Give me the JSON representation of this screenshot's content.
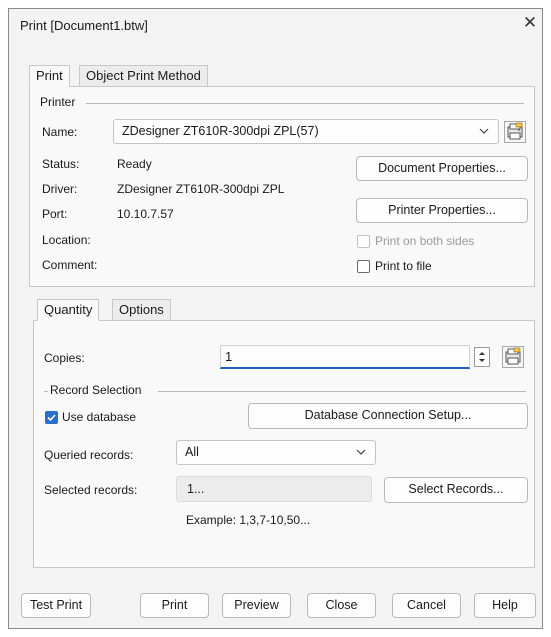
{
  "window": {
    "title": "Print [Document1.btw]",
    "close_glyph": "✕"
  },
  "tabs_top": [
    "Print",
    "Object Print Method"
  ],
  "printer": {
    "group_label": "Printer",
    "name_label": "Name:",
    "name_value": "ZDesigner ZT610R-300dpi ZPL(57)",
    "status_label": "Status:",
    "status_value": "Ready",
    "driver_label": "Driver:",
    "driver_value": "ZDesigner ZT610R-300dpi ZPL",
    "port_label": "Port:",
    "port_value": "10.10.7.57",
    "location_label": "Location:",
    "comment_label": "Comment:",
    "doc_props_button": "Document Properties...",
    "printer_props_button": "Printer Properties...",
    "both_sides_label": "Print on both sides",
    "both_sides_checked": false,
    "to_file_label": "Print to file",
    "to_file_checked": false
  },
  "tabs_lower": [
    "Quantity",
    "Options"
  ],
  "quantity": {
    "copies_label": "Copies:",
    "copies_value": "1",
    "record_selection_label": "Record Selection",
    "use_database_label": "Use database",
    "use_database_checked": true,
    "db_setup_button": "Database Connection Setup...",
    "queried_label": "Queried records:",
    "queried_value": "All",
    "selected_label": "Selected records:",
    "selected_value": "1...",
    "select_records_button": "Select Records...",
    "example_text": "Example: 1,3,7-10,50..."
  },
  "footer": {
    "test_print": "Test Print",
    "print": "Print",
    "preview": "Preview",
    "close": "Close",
    "cancel": "Cancel",
    "help": "Help"
  },
  "colors": {
    "accent": "#2a6fc9",
    "focus_underline": "#1f5fbf"
  }
}
